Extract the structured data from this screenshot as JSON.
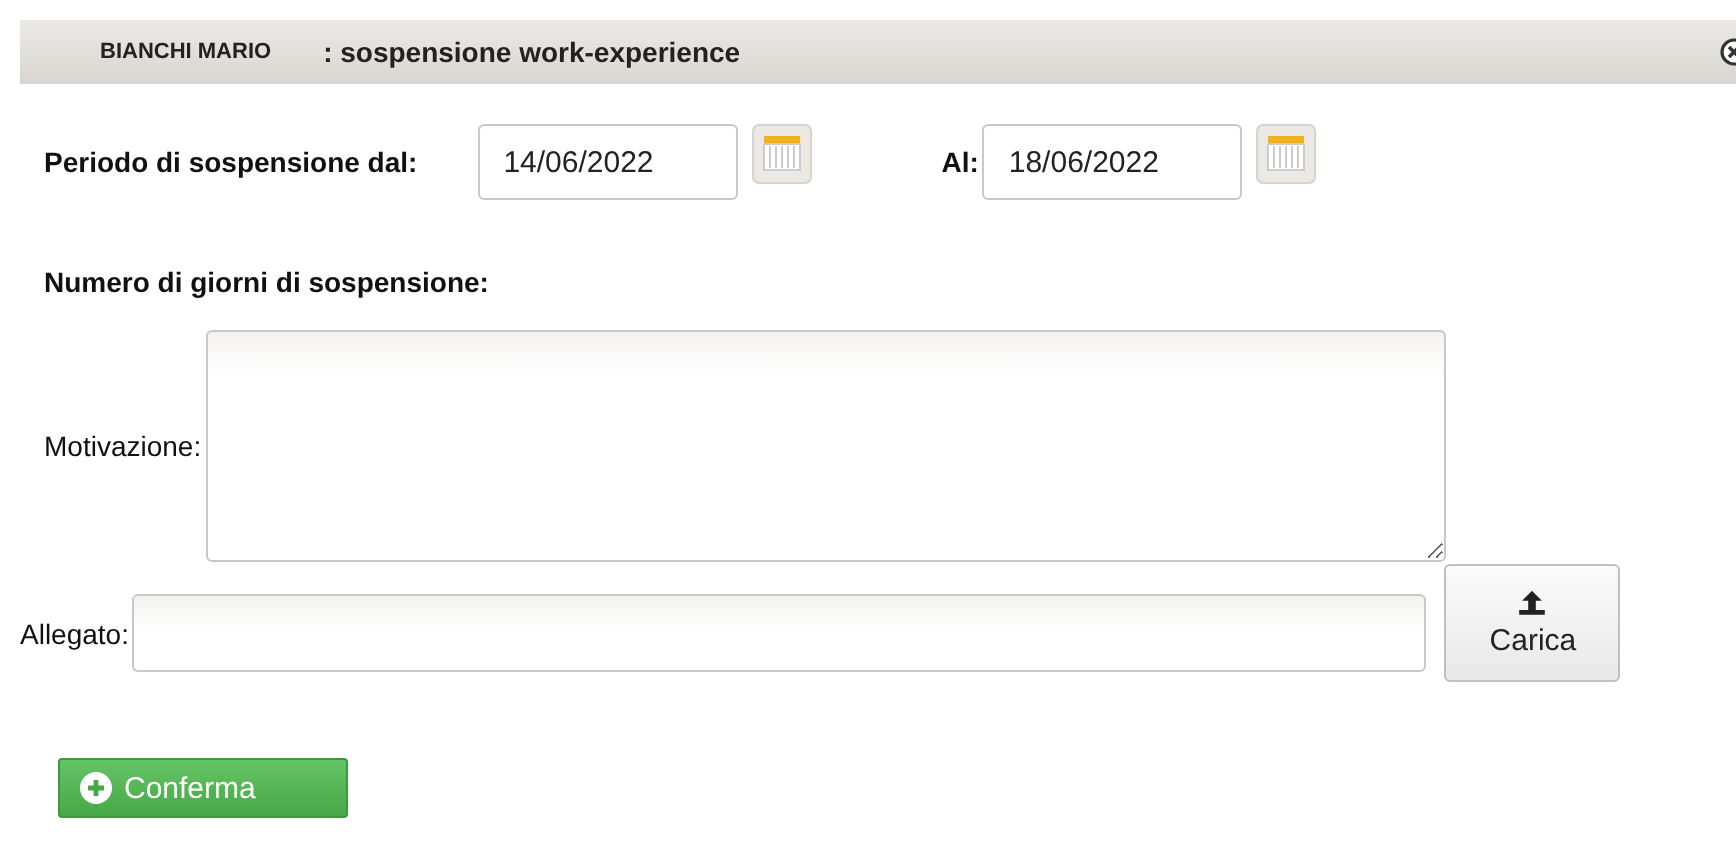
{
  "window": {
    "name": "BIANCHI MARIO",
    "title": ": sospensione work-experience"
  },
  "period": {
    "from_label": "Periodo di sospensione dal:",
    "from_value": "14/06/2022",
    "to_label": "Al:",
    "to_value": "18/06/2022"
  },
  "days_label": "Numero di giorni di sospensione:",
  "reason": {
    "label": "Motivazione:"
  },
  "attachment": {
    "label": "Allegato:",
    "button": "Carica"
  },
  "confirm_button": "Conferma"
}
